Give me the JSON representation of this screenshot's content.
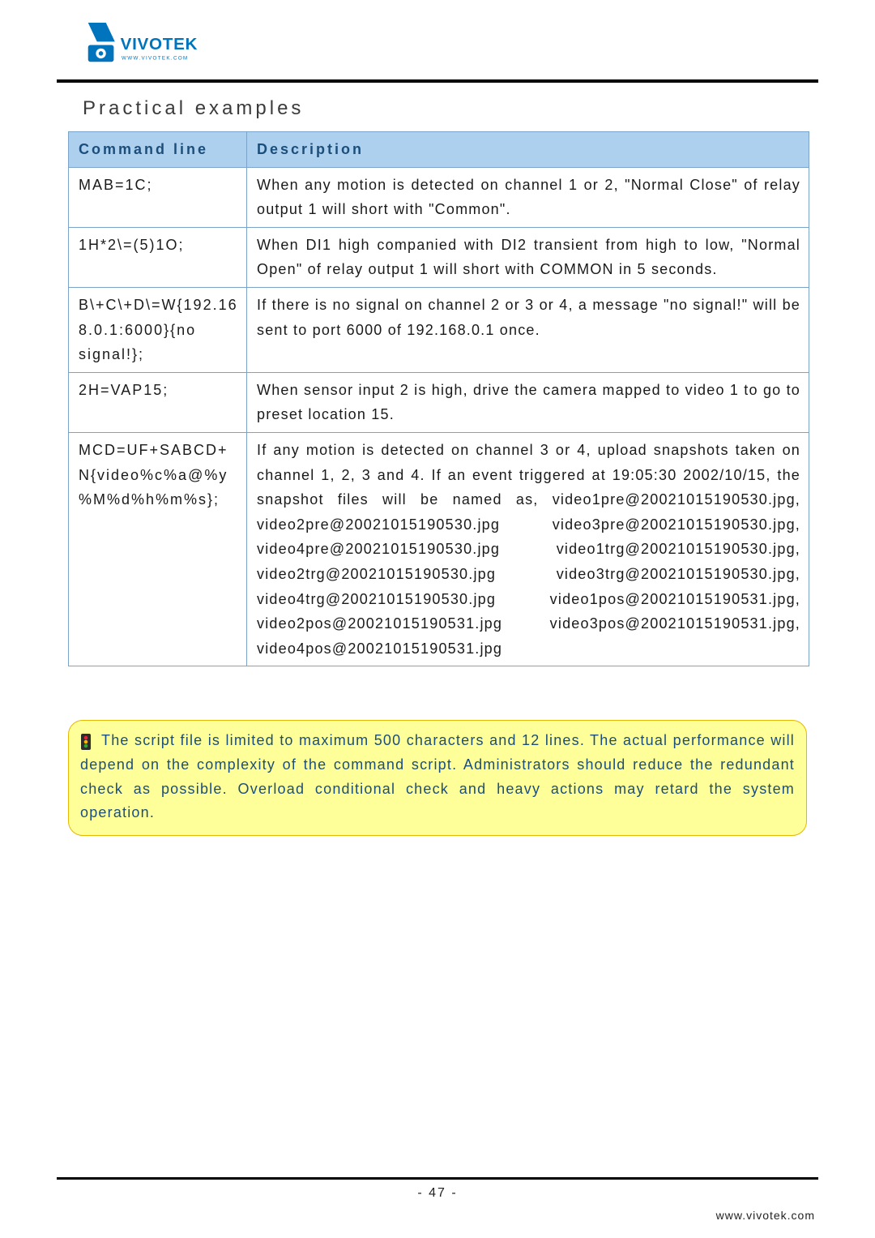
{
  "section_title": "Practical examples",
  "table": {
    "headers": {
      "col1": "Command line",
      "col2": "Description"
    },
    "rows": [
      {
        "cmd": "MAB=1C;",
        "desc": "When any motion is detected on channel 1 or 2, \"Normal Close\" of relay output 1 will short with \"Common\"."
      },
      {
        "cmd": "1H*2\\=(5)1O;",
        "desc": "When DI1 high companied with DI2 transient from high to low, \"Normal Open\" of relay output 1 will short with COMMON in 5 seconds."
      },
      {
        "cmd": "B\\+C\\+D\\=W{192.168.0.1:6000}{no signal!};",
        "desc": "If there is no signal on channel 2 or 3 or 4, a message \"no signal!\" will be sent to port 6000 of 192.168.0.1 once."
      },
      {
        "cmd": "2H=VAP15;",
        "desc": "When sensor input 2 is high, drive the camera mapped to video 1 to go to preset location 15."
      },
      {
        "cmd": "MCD=UF+SABCD+N{video%c%a@%y%M%d%h%m%s};",
        "desc": "If any motion is detected on channel 3 or 4, upload snapshots taken on channel 1, 2, 3 and 4. If an event triggered at 19:05:30 2002/10/15, the snapshot files will be named as, video1pre@20021015190530.jpg, video2pre@20021015190530.jpg video3pre@20021015190530.jpg, video4pre@20021015190530.jpg video1trg@20021015190530.jpg, video2trg@20021015190530.jpg video3trg@20021015190530.jpg, video4trg@20021015190530.jpg video1pos@20021015190531.jpg, video2pos@20021015190531.jpg video3pos@20021015190531.jpg, video4pos@20021015190531.jpg"
      }
    ]
  },
  "note_text": "The script file is limited to maximum 500 characters and 12 lines. The actual performance will depend on the complexity of the command script. Administrators should reduce the redundant check as possible. Overload conditional check and heavy actions may retard the system operation.",
  "page_number": "- 47 -",
  "footer_url": "www.vivotek.com",
  "logo_text": "VIVOTEK",
  "logo_url_text": "www.vivotek.com"
}
